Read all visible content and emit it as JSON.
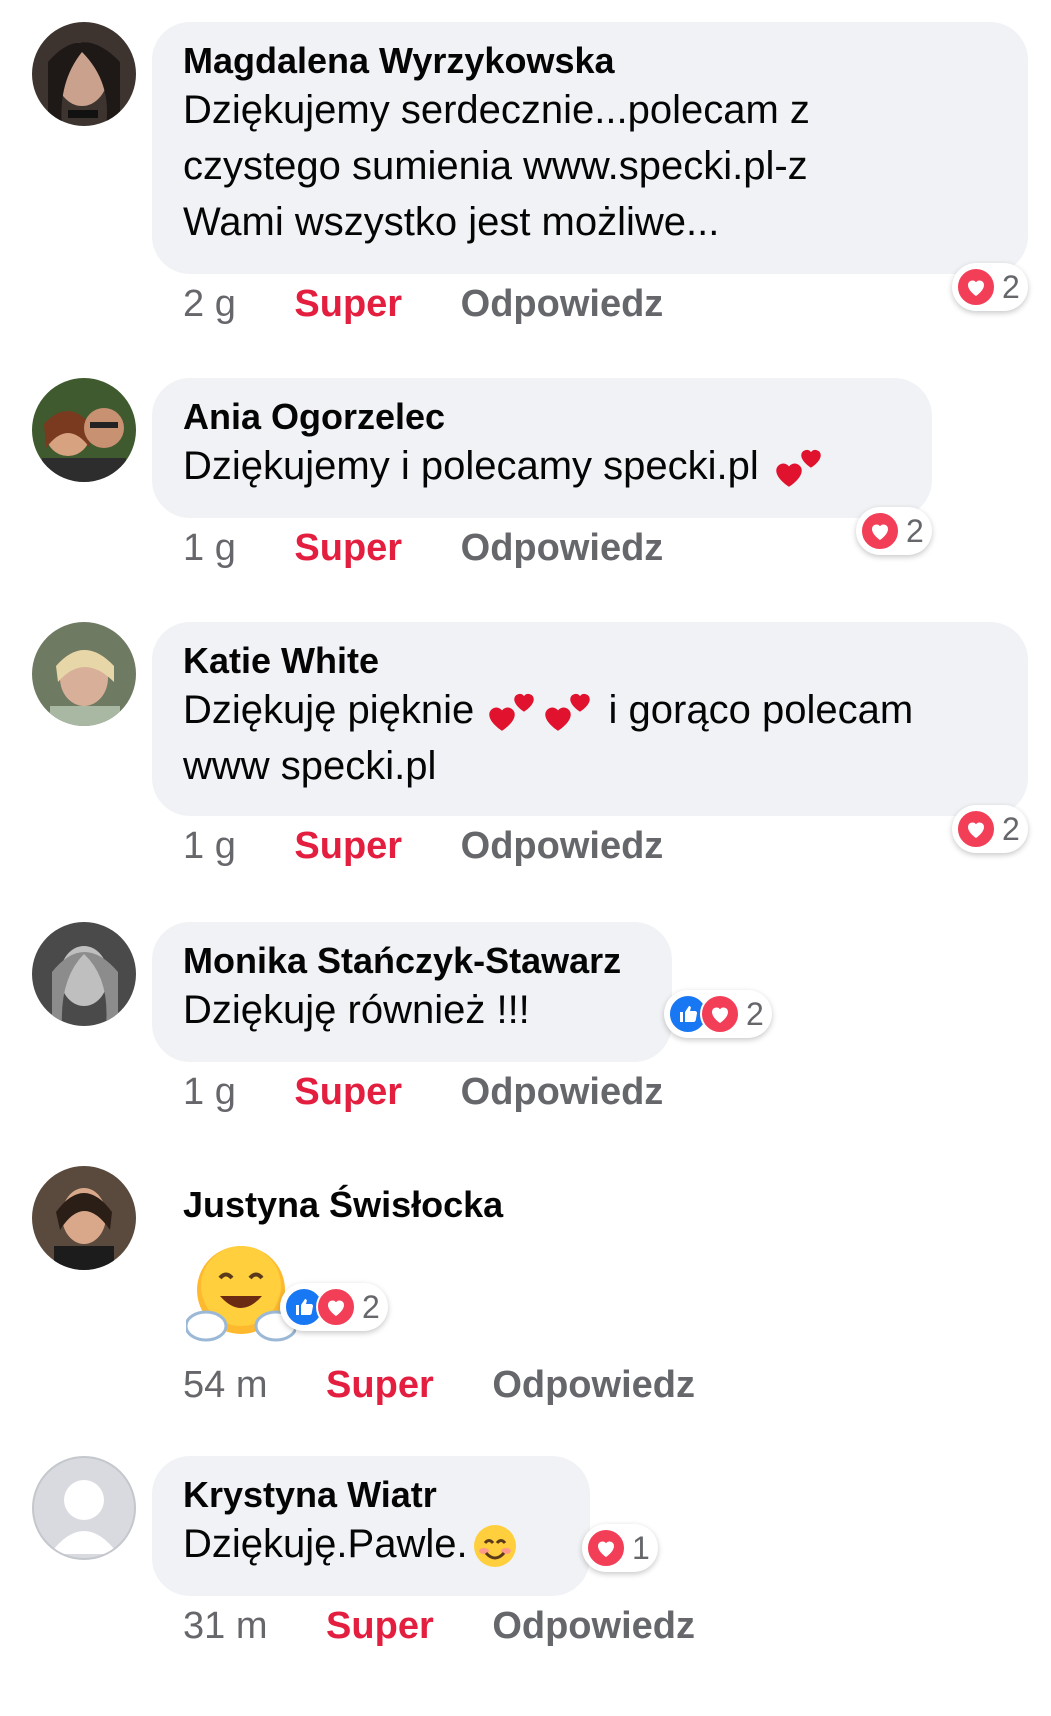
{
  "colors": {
    "bubble": "#f0f2f5",
    "love": "#f33e58",
    "like": "#1877f2",
    "super": "#e41e3f",
    "meta": "#65676b"
  },
  "actions": {
    "super": "Super",
    "reply": "Odpowiedz"
  },
  "comments": [
    {
      "author": "Magdalena Wyrzykowska",
      "text": [
        "Dziękujemy serdecznie...polecam z",
        "czystego sumienia www.specki.pl-z",
        "Wami wszystko jest możliwe..."
      ],
      "time": "2 g",
      "reactions": [
        "love-icon"
      ],
      "count": "2"
    },
    {
      "author": "Ania Ogorzelec",
      "text": [
        "Dziękujemy i polecamy specki.pl"
      ],
      "time": "1 g",
      "reactions": [
        "love-icon"
      ],
      "count": "2"
    },
    {
      "author": "Katie White",
      "text": [
        "Dziękuję pięknie",
        "i gorąco polecam",
        "www specki.pl"
      ],
      "time": "1 g",
      "reactions": [
        "love-icon"
      ],
      "count": "2"
    },
    {
      "author": "Monika Stańczyk-Stawarz",
      "text": [
        "Dziękuję również !!!"
      ],
      "time": "1 g",
      "reactions": [
        "like-icon",
        "love-icon"
      ],
      "count": "2"
    },
    {
      "author": "Justyna Świsłocka",
      "text": [],
      "time": "54 m",
      "reactions": [
        "like-icon",
        "love-icon"
      ],
      "count": "2",
      "emoji": "hugging-face-emoji"
    },
    {
      "author": "Krystyna Wiatr",
      "text": [
        "Dziękuję.Pawle."
      ],
      "time": "31 m",
      "reactions": [
        "love-icon"
      ],
      "count": "1"
    }
  ]
}
